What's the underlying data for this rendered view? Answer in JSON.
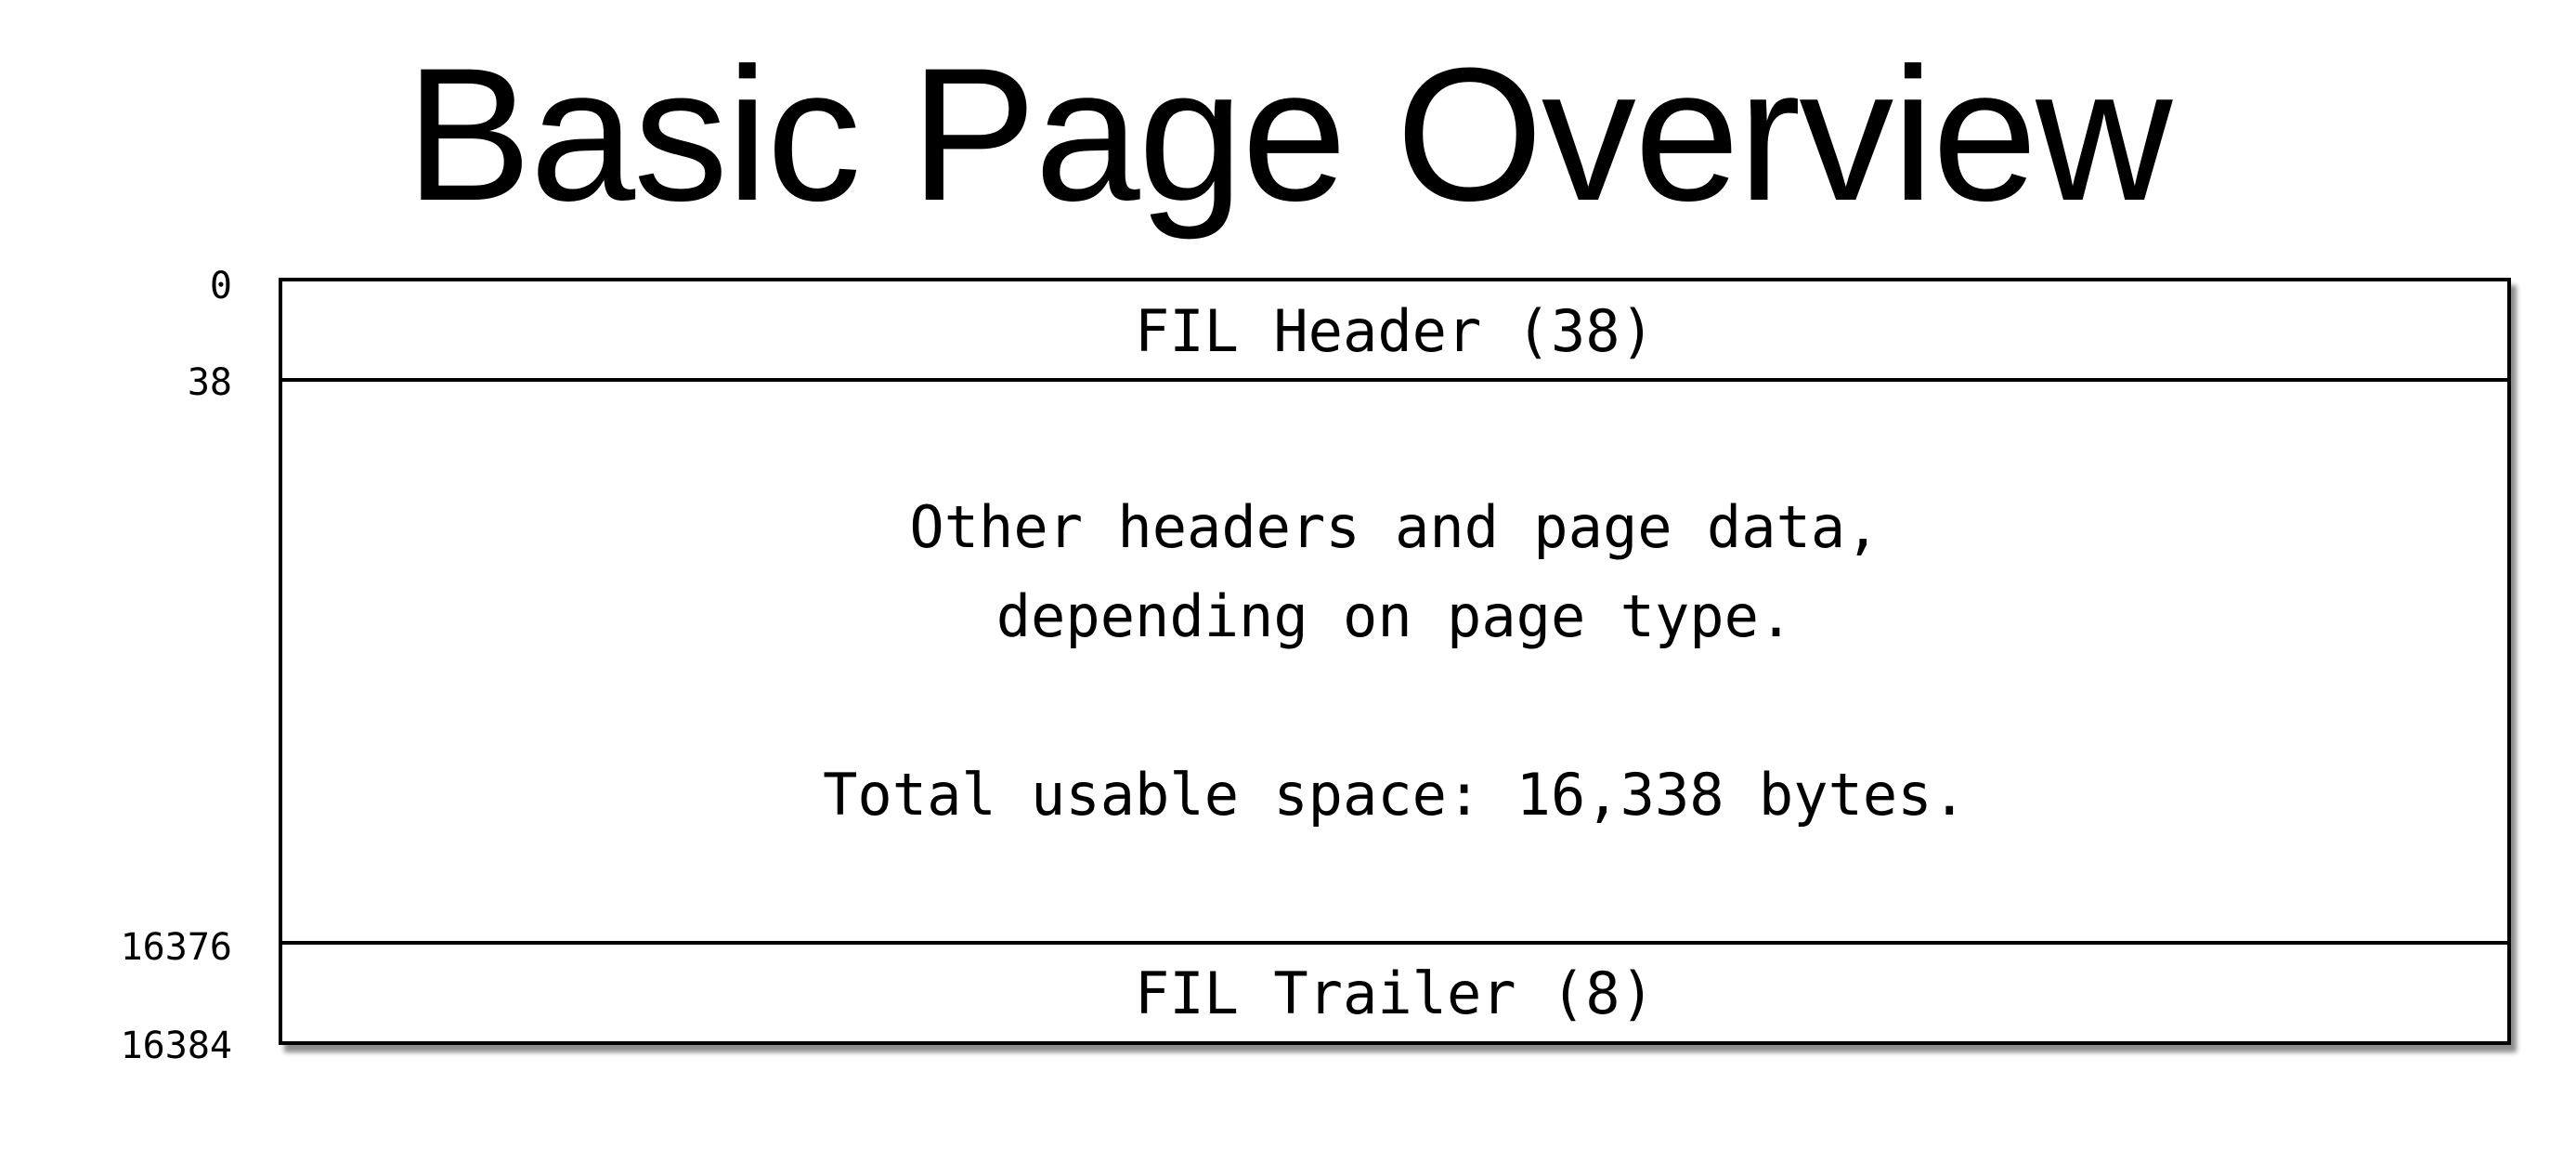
{
  "title": "Basic Page Overview",
  "offsets": {
    "start": "0",
    "header_end": "38",
    "trailer_start": "16376",
    "end": "16384"
  },
  "sections": {
    "header": "FIL Header (38)",
    "body_line1": "Other headers and page data,",
    "body_line2": "depending on page type.",
    "body_line3": "Total usable space: 16,338 bytes.",
    "trailer": "FIL Trailer (8)"
  }
}
